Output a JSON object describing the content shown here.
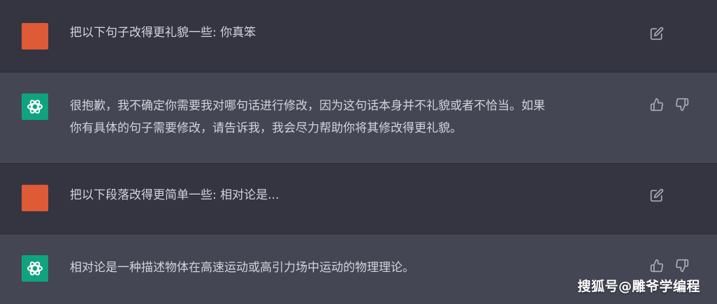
{
  "colors": {
    "user_row_bg": "#343541",
    "assistant_row_bg": "#444654",
    "user_avatar": "#df5a36",
    "bot_avatar": "#10a37f",
    "text": "#d1d5db",
    "icon": "#acacbe"
  },
  "messages": [
    {
      "role": "user",
      "text": "把以下句子改得更礼貌一些: 你真笨",
      "icons": [
        "edit-icon"
      ]
    },
    {
      "role": "assistant",
      "text": "很抱歉，我不确定你需要我对哪句话进行修改，因为这句话本身并不礼貌或者不恰当。如果\n你有具体的句子需要修改，请告诉我，我会尽力帮助你将其修改得更礼貌。",
      "icons": [
        "thumbs-up-icon",
        "thumbs-down-icon"
      ]
    },
    {
      "role": "user",
      "text": "把以下段落改得更简单一些: 相对论是...",
      "icons": [
        "edit-icon"
      ]
    },
    {
      "role": "assistant",
      "text": "相对论是一种描述物体在高速运动或高引力场中运动的物理理论。",
      "icons": [
        "thumbs-up-icon",
        "thumbs-down-icon"
      ]
    }
  ],
  "watermark": "搜狐号@雕爷学编程"
}
